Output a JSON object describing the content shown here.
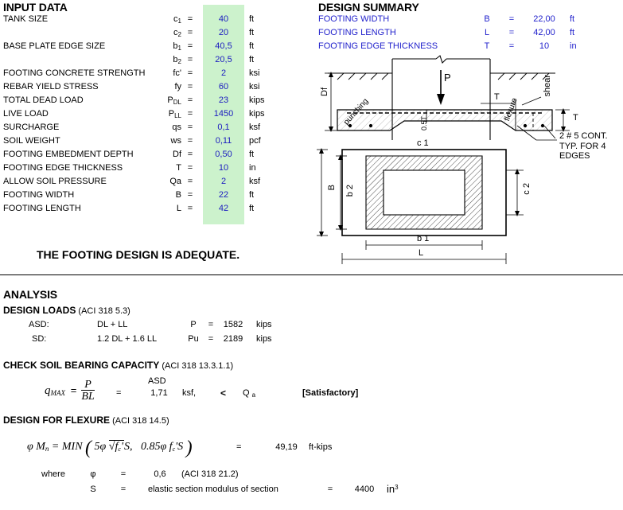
{
  "input": {
    "title": "INPUT DATA",
    "rows": [
      {
        "label": "TANK SIZE",
        "symbol": "c",
        "sub": "1",
        "eq": "=",
        "value": "40",
        "unit": "ft"
      },
      {
        "label": "",
        "symbol": "c",
        "sub": "2",
        "eq": "=",
        "value": "20",
        "unit": "ft"
      },
      {
        "label": "BASE PLATE EDGE SIZE",
        "symbol": "b",
        "sub": "1",
        "eq": "=",
        "value": "40,5",
        "unit": "ft"
      },
      {
        "label": "",
        "symbol": "b",
        "sub": "2",
        "eq": "=",
        "value": "20,5",
        "unit": "ft"
      },
      {
        "label": "FOOTING CONCRETE STRENGTH",
        "symbol": "fc'",
        "sub": "",
        "eq": "=",
        "value": "2",
        "unit": "ksi"
      },
      {
        "label": "REBAR YIELD STRESS",
        "symbol": "fy",
        "sub": "",
        "eq": "=",
        "value": "60",
        "unit": "ksi"
      },
      {
        "label": "TOTAL DEAD LOAD",
        "symbol": "P",
        "sub": "DL",
        "eq": "=",
        "value": "23",
        "unit": "kips"
      },
      {
        "label": "LIVE LOAD",
        "symbol": "P",
        "sub": "LL",
        "eq": "=",
        "value": "1450",
        "unit": "kips"
      },
      {
        "label": "SURCHARGE",
        "symbol": "qs",
        "sub": "",
        "eq": "=",
        "value": "0,1",
        "unit": "ksf"
      },
      {
        "label": "SOIL WEIGHT",
        "symbol": "ws",
        "sub": "",
        "eq": "=",
        "value": "0,11",
        "unit": "pcf"
      },
      {
        "label": "FOOTING EMBEDMENT DEPTH",
        "symbol": "Df",
        "sub": "",
        "eq": "=",
        "value": "0,50",
        "unit": "ft"
      },
      {
        "label": "FOOTING EDGE THICKNESS",
        "symbol": "T",
        "sub": "",
        "eq": "=",
        "value": "10",
        "unit": "in"
      },
      {
        "label": "ALLOW SOIL PRESSURE",
        "symbol": "Qa",
        "sub": "",
        "eq": "=",
        "value": "2",
        "unit": "ksf"
      },
      {
        "label": "FOOTING WIDTH",
        "symbol": "B",
        "sub": "",
        "eq": "=",
        "value": "22",
        "unit": "ft"
      },
      {
        "label": "FOOTING LENGTH",
        "symbol": "L",
        "sub": "",
        "eq": "=",
        "value": "42",
        "unit": "ft"
      }
    ],
    "verdict": "THE FOOTING DESIGN IS ADEQUATE."
  },
  "summary": {
    "title": "DESIGN SUMMARY",
    "rows": [
      {
        "label": "FOOTING WIDTH",
        "symbol": "B",
        "eq": "=",
        "value": "22,00",
        "unit": "ft"
      },
      {
        "label": "FOOTING LENGTH",
        "symbol": "L",
        "eq": "=",
        "value": "42,00",
        "unit": "ft"
      },
      {
        "label": "FOOTING EDGE THICKNESS",
        "symbol": "T",
        "eq": "=",
        "value": "10",
        "unit": "in"
      }
    ]
  },
  "diagram": {
    "load_label": "P",
    "depth_label": "Df",
    "thickness_label": "T",
    "half_thickness_label": "0.5T",
    "punching_label": "punching",
    "flexure_label": "flexure",
    "shear_label": "shear",
    "rebar_note_line1": "2  #  5  CONT.",
    "rebar_note_line2": "TYP.  FOR  4  EDGES",
    "plan_c1": "c 1",
    "plan_c2": "c 2",
    "plan_b1": "b 1",
    "plan_b2": "b 2",
    "plan_B": "B",
    "plan_L": "L"
  },
  "analysis": {
    "title": "ANALYSIS",
    "loads": {
      "heading": "DESIGN  LOADS",
      "heading_ref": "(ACI 318 5.3)",
      "rows": [
        {
          "case": "ASD:",
          "combo": "DL + LL",
          "symbol": "P",
          "eq": "=",
          "value": "1582",
          "unit": "kips"
        },
        {
          "case": "SD:",
          "combo": "1.2 DL + 1.6 LL",
          "symbol": "Pu",
          "eq": "=",
          "value": "2189",
          "unit": "kips"
        }
      ]
    },
    "soil": {
      "heading": "CHECK SOIL BEARING CAPACITY",
      "heading_ref": "(ACI 318 13.3.1.1)",
      "formula_lhs": "q",
      "formula_lhs_sub": "MAX",
      "formula_num": "P",
      "formula_den": "BL",
      "eq": "=",
      "mode": "ASD",
      "value": "1,71",
      "unit": "ksf,",
      "compare": "<",
      "limit": "Q",
      "limit_sub": "a",
      "result": "[Satisfactory]"
    },
    "flexure": {
      "heading": "DESIGN FOR FLEXURE",
      "heading_ref": "(ACI 318 14.5)",
      "formula": "φ Mₙ = MIN( 5φ √f'c S ,  0.85φ f'c S )",
      "eq": "=",
      "value": "49,19",
      "unit": "ft-kips",
      "where_label": "where",
      "phi_symbol": "φ",
      "phi_eq": "=",
      "phi_value": "0,6",
      "phi_ref": "(ACI 318 21.2)",
      "s_symbol": "S",
      "s_eq": "=",
      "s_desc": "elastic section modulus of section",
      "s_eq2": "=",
      "s_value": "4400",
      "s_unit": "in",
      "s_unit_sup": "3"
    }
  }
}
